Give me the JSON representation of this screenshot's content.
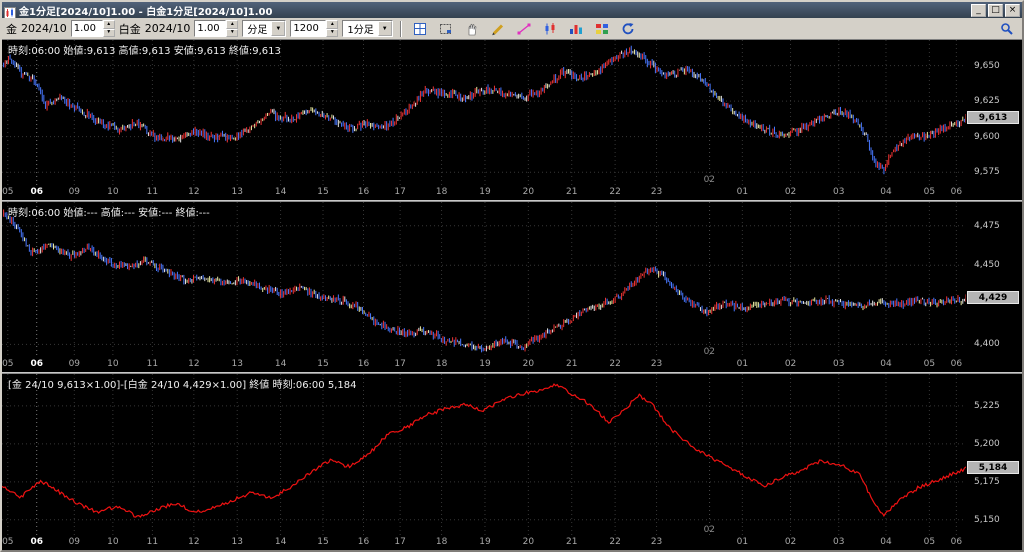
{
  "window": {
    "title": "金1分足[2024/10]1.00 - 白金1分足[2024/10]1.00",
    "controls": {
      "minimize": "_",
      "maximize": "□",
      "close": "×"
    }
  },
  "toolbar": {
    "gold_label": "金",
    "gold_month": "2024/10",
    "gold_multiplier": "1.00",
    "platinum_label": "白金",
    "platinum_month": "2024/10",
    "platinum_multiplier": "1.00",
    "period_type": "分足",
    "bar_count": "1200",
    "timeframe": "1分足",
    "icons": [
      "grid-table-icon",
      "select-region-icon",
      "pan-hand-icon",
      "pencil-draw-icon",
      "trendline-icon",
      "candlestick-icon",
      "bar-chart-icon",
      "indicator-grid-icon",
      "refresh-icon",
      "magnifier-icon"
    ]
  },
  "x_axis": {
    "date_marker": "02",
    "date_x": 0.734,
    "labels": [
      {
        "t": "05",
        "x": 0.006,
        "em": false
      },
      {
        "t": "06",
        "x": 0.036,
        "em": true
      },
      {
        "t": "09",
        "x": 0.075,
        "em": false
      },
      {
        "t": "10",
        "x": 0.115,
        "em": false
      },
      {
        "t": "11",
        "x": 0.156,
        "em": false
      },
      {
        "t": "12",
        "x": 0.199,
        "em": false
      },
      {
        "t": "13",
        "x": 0.244,
        "em": false
      },
      {
        "t": "14",
        "x": 0.289,
        "em": false
      },
      {
        "t": "15",
        "x": 0.333,
        "em": false
      },
      {
        "t": "16",
        "x": 0.375,
        "em": false
      },
      {
        "t": "17",
        "x": 0.413,
        "em": false
      },
      {
        "t": "18",
        "x": 0.456,
        "em": false
      },
      {
        "t": "19",
        "x": 0.501,
        "em": false
      },
      {
        "t": "20",
        "x": 0.546,
        "em": false
      },
      {
        "t": "21",
        "x": 0.591,
        "em": false
      },
      {
        "t": "22",
        "x": 0.636,
        "em": false
      },
      {
        "t": "23",
        "x": 0.679,
        "em": false
      },
      {
        "t": "01",
        "x": 0.768,
        "em": false
      },
      {
        "t": "02",
        "x": 0.818,
        "em": false
      },
      {
        "t": "03",
        "x": 0.868,
        "em": false
      },
      {
        "t": "04",
        "x": 0.917,
        "em": false
      },
      {
        "t": "05",
        "x": 0.962,
        "em": false
      },
      {
        "t": "06",
        "x": 0.99,
        "em": false
      }
    ]
  },
  "charts": [
    {
      "name": "gold",
      "type": "candle",
      "info": "時刻:06:00 始値:9,613 高値:9,613 安値:9,613 終値:9,613",
      "y_ticks": [
        {
          "v": 9650,
          "label": "9,650"
        },
        {
          "v": 9625,
          "label": "9,625"
        },
        {
          "v": 9600,
          "label": "9,600"
        },
        {
          "v": 9575,
          "label": "9,575"
        }
      ],
      "y_min": 9566,
      "y_max": 9668,
      "current": "9,613",
      "current_value": 9613,
      "noise": 2.2,
      "wick": 2.4,
      "colors": {
        "up": "#f03434",
        "down": "#4878ff",
        "flat1": "#e8e8a0",
        "flat2": "#e4e4e4"
      },
      "points": [
        [
          0,
          9650
        ],
        [
          0.008,
          9656
        ],
        [
          0.02,
          9645
        ],
        [
          0.035,
          9638
        ],
        [
          0.045,
          9622
        ],
        [
          0.06,
          9628
        ],
        [
          0.08,
          9618
        ],
        [
          0.1,
          9611
        ],
        [
          0.12,
          9605
        ],
        [
          0.14,
          9609
        ],
        [
          0.16,
          9600
        ],
        [
          0.18,
          9598
        ],
        [
          0.2,
          9603
        ],
        [
          0.22,
          9600
        ],
        [
          0.24,
          9599
        ],
        [
          0.26,
          9607
        ],
        [
          0.28,
          9616
        ],
        [
          0.3,
          9612
        ],
        [
          0.32,
          9618
        ],
        [
          0.34,
          9613
        ],
        [
          0.36,
          9606
        ],
        [
          0.38,
          9609
        ],
        [
          0.4,
          9607
        ],
        [
          0.42,
          9618
        ],
        [
          0.44,
          9633
        ],
        [
          0.46,
          9630
        ],
        [
          0.48,
          9628
        ],
        [
          0.5,
          9633
        ],
        [
          0.52,
          9631
        ],
        [
          0.54,
          9628
        ],
        [
          0.56,
          9633
        ],
        [
          0.58,
          9645
        ],
        [
          0.6,
          9641
        ],
        [
          0.62,
          9647
        ],
        [
          0.64,
          9657
        ],
        [
          0.655,
          9661
        ],
        [
          0.67,
          9652
        ],
        [
          0.69,
          9642
        ],
        [
          0.71,
          9648
        ],
        [
          0.73,
          9638
        ],
        [
          0.75,
          9622
        ],
        [
          0.77,
          9612
        ],
        [
          0.79,
          9606
        ],
        [
          0.81,
          9600
        ],
        [
          0.83,
          9606
        ],
        [
          0.85,
          9613
        ],
        [
          0.87,
          9618
        ],
        [
          0.88,
          9614
        ],
        [
          0.895,
          9603
        ],
        [
          0.905,
          9582
        ],
        [
          0.915,
          9576
        ],
        [
          0.925,
          9592
        ],
        [
          0.94,
          9599
        ],
        [
          0.96,
          9601
        ],
        [
          0.98,
          9606
        ],
        [
          1,
          9613
        ]
      ]
    },
    {
      "name": "platinum",
      "type": "candle",
      "info": "時刻:06:00 始値:--- 高値:--- 安値:--- 終値:---",
      "y_ticks": [
        {
          "v": 4475,
          "label": "4,475"
        },
        {
          "v": 4450,
          "label": "4,450"
        },
        {
          "v": 4400,
          "label": "4,400"
        }
      ],
      "y_min": 4392,
      "y_max": 4490,
      "current": "4,429",
      "current_value": 4429,
      "noise": 1.8,
      "wick": 2.0,
      "colors": {
        "up": "#f03434",
        "down": "#4878ff",
        "flat1": "#e8e8a0",
        "flat2": "#e4e4e4"
      },
      "points": [
        [
          0,
          4483
        ],
        [
          0.01,
          4478
        ],
        [
          0.02,
          4468
        ],
        [
          0.03,
          4458
        ],
        [
          0.05,
          4463
        ],
        [
          0.07,
          4456
        ],
        [
          0.09,
          4461
        ],
        [
          0.11,
          4452
        ],
        [
          0.13,
          4448
        ],
        [
          0.15,
          4453
        ],
        [
          0.17,
          4446
        ],
        [
          0.19,
          4440
        ],
        [
          0.21,
          4443
        ],
        [
          0.23,
          4438
        ],
        [
          0.25,
          4441
        ],
        [
          0.27,
          4436
        ],
        [
          0.29,
          4432
        ],
        [
          0.31,
          4436
        ],
        [
          0.33,
          4430
        ],
        [
          0.35,
          4428
        ],
        [
          0.37,
          4424
        ],
        [
          0.385,
          4415
        ],
        [
          0.4,
          4411
        ],
        [
          0.42,
          4406
        ],
        [
          0.44,
          4409
        ],
        [
          0.46,
          4402
        ],
        [
          0.48,
          4400
        ],
        [
          0.5,
          4397
        ],
        [
          0.52,
          4403
        ],
        [
          0.54,
          4398
        ],
        [
          0.56,
          4406
        ],
        [
          0.58,
          4412
        ],
        [
          0.6,
          4420
        ],
        [
          0.62,
          4425
        ],
        [
          0.64,
          4430
        ],
        [
          0.66,
          4442
        ],
        [
          0.675,
          4448
        ],
        [
          0.69,
          4441
        ],
        [
          0.71,
          4428
        ],
        [
          0.73,
          4420
        ],
        [
          0.75,
          4426
        ],
        [
          0.77,
          4422
        ],
        [
          0.79,
          4426
        ],
        [
          0.81,
          4428
        ],
        [
          0.83,
          4425
        ],
        [
          0.85,
          4428
        ],
        [
          0.87,
          4426
        ],
        [
          0.89,
          4424
        ],
        [
          0.91,
          4427
        ],
        [
          0.93,
          4425
        ],
        [
          0.95,
          4428
        ],
        [
          0.97,
          4426
        ],
        [
          1,
          4429
        ]
      ]
    },
    {
      "name": "spread",
      "type": "line",
      "info": "[金 24/10 9,613×1.00]-[白金 24/10 4,429×1.00] 終値 時刻:06:00 5,184",
      "y_ticks": [
        {
          "v": 5225,
          "label": "5,225"
        },
        {
          "v": 5200,
          "label": "5,200"
        },
        {
          "v": 5175,
          "label": "5,175"
        },
        {
          "v": 5150,
          "label": "5,150"
        }
      ],
      "y_min": 5140,
      "y_max": 5246,
      "current": "5,184",
      "current_value": 5184,
      "noise": 1.2,
      "colors": {
        "line": "#ee1212"
      },
      "points": [
        [
          0,
          5172
        ],
        [
          0.02,
          5165
        ],
        [
          0.04,
          5176
        ],
        [
          0.06,
          5168
        ],
        [
          0.08,
          5160
        ],
        [
          0.1,
          5155
        ],
        [
          0.12,
          5159
        ],
        [
          0.14,
          5152
        ],
        [
          0.16,
          5157
        ],
        [
          0.18,
          5161
        ],
        [
          0.2,
          5155
        ],
        [
          0.22,
          5158
        ],
        [
          0.24,
          5163
        ],
        [
          0.26,
          5168
        ],
        [
          0.28,
          5164
        ],
        [
          0.3,
          5172
        ],
        [
          0.32,
          5181
        ],
        [
          0.34,
          5189
        ],
        [
          0.36,
          5185
        ],
        [
          0.38,
          5193
        ],
        [
          0.4,
          5206
        ],
        [
          0.42,
          5211
        ],
        [
          0.44,
          5219
        ],
        [
          0.46,
          5223
        ],
        [
          0.48,
          5226
        ],
        [
          0.5,
          5222
        ],
        [
          0.52,
          5229
        ],
        [
          0.54,
          5233
        ],
        [
          0.56,
          5236
        ],
        [
          0.575,
          5239
        ],
        [
          0.59,
          5233
        ],
        [
          0.61,
          5226
        ],
        [
          0.63,
          5214
        ],
        [
          0.645,
          5222
        ],
        [
          0.66,
          5232
        ],
        [
          0.675,
          5226
        ],
        [
          0.69,
          5212
        ],
        [
          0.71,
          5201
        ],
        [
          0.73,
          5193
        ],
        [
          0.75,
          5186
        ],
        [
          0.77,
          5179
        ],
        [
          0.79,
          5172
        ],
        [
          0.81,
          5178
        ],
        [
          0.83,
          5183
        ],
        [
          0.85,
          5189
        ],
        [
          0.87,
          5186
        ],
        [
          0.89,
          5180
        ],
        [
          0.905,
          5160
        ],
        [
          0.915,
          5153
        ],
        [
          0.93,
          5163
        ],
        [
          0.95,
          5171
        ],
        [
          0.97,
          5176
        ],
        [
          0.985,
          5180
        ],
        [
          1,
          5184
        ]
      ]
    }
  ]
}
